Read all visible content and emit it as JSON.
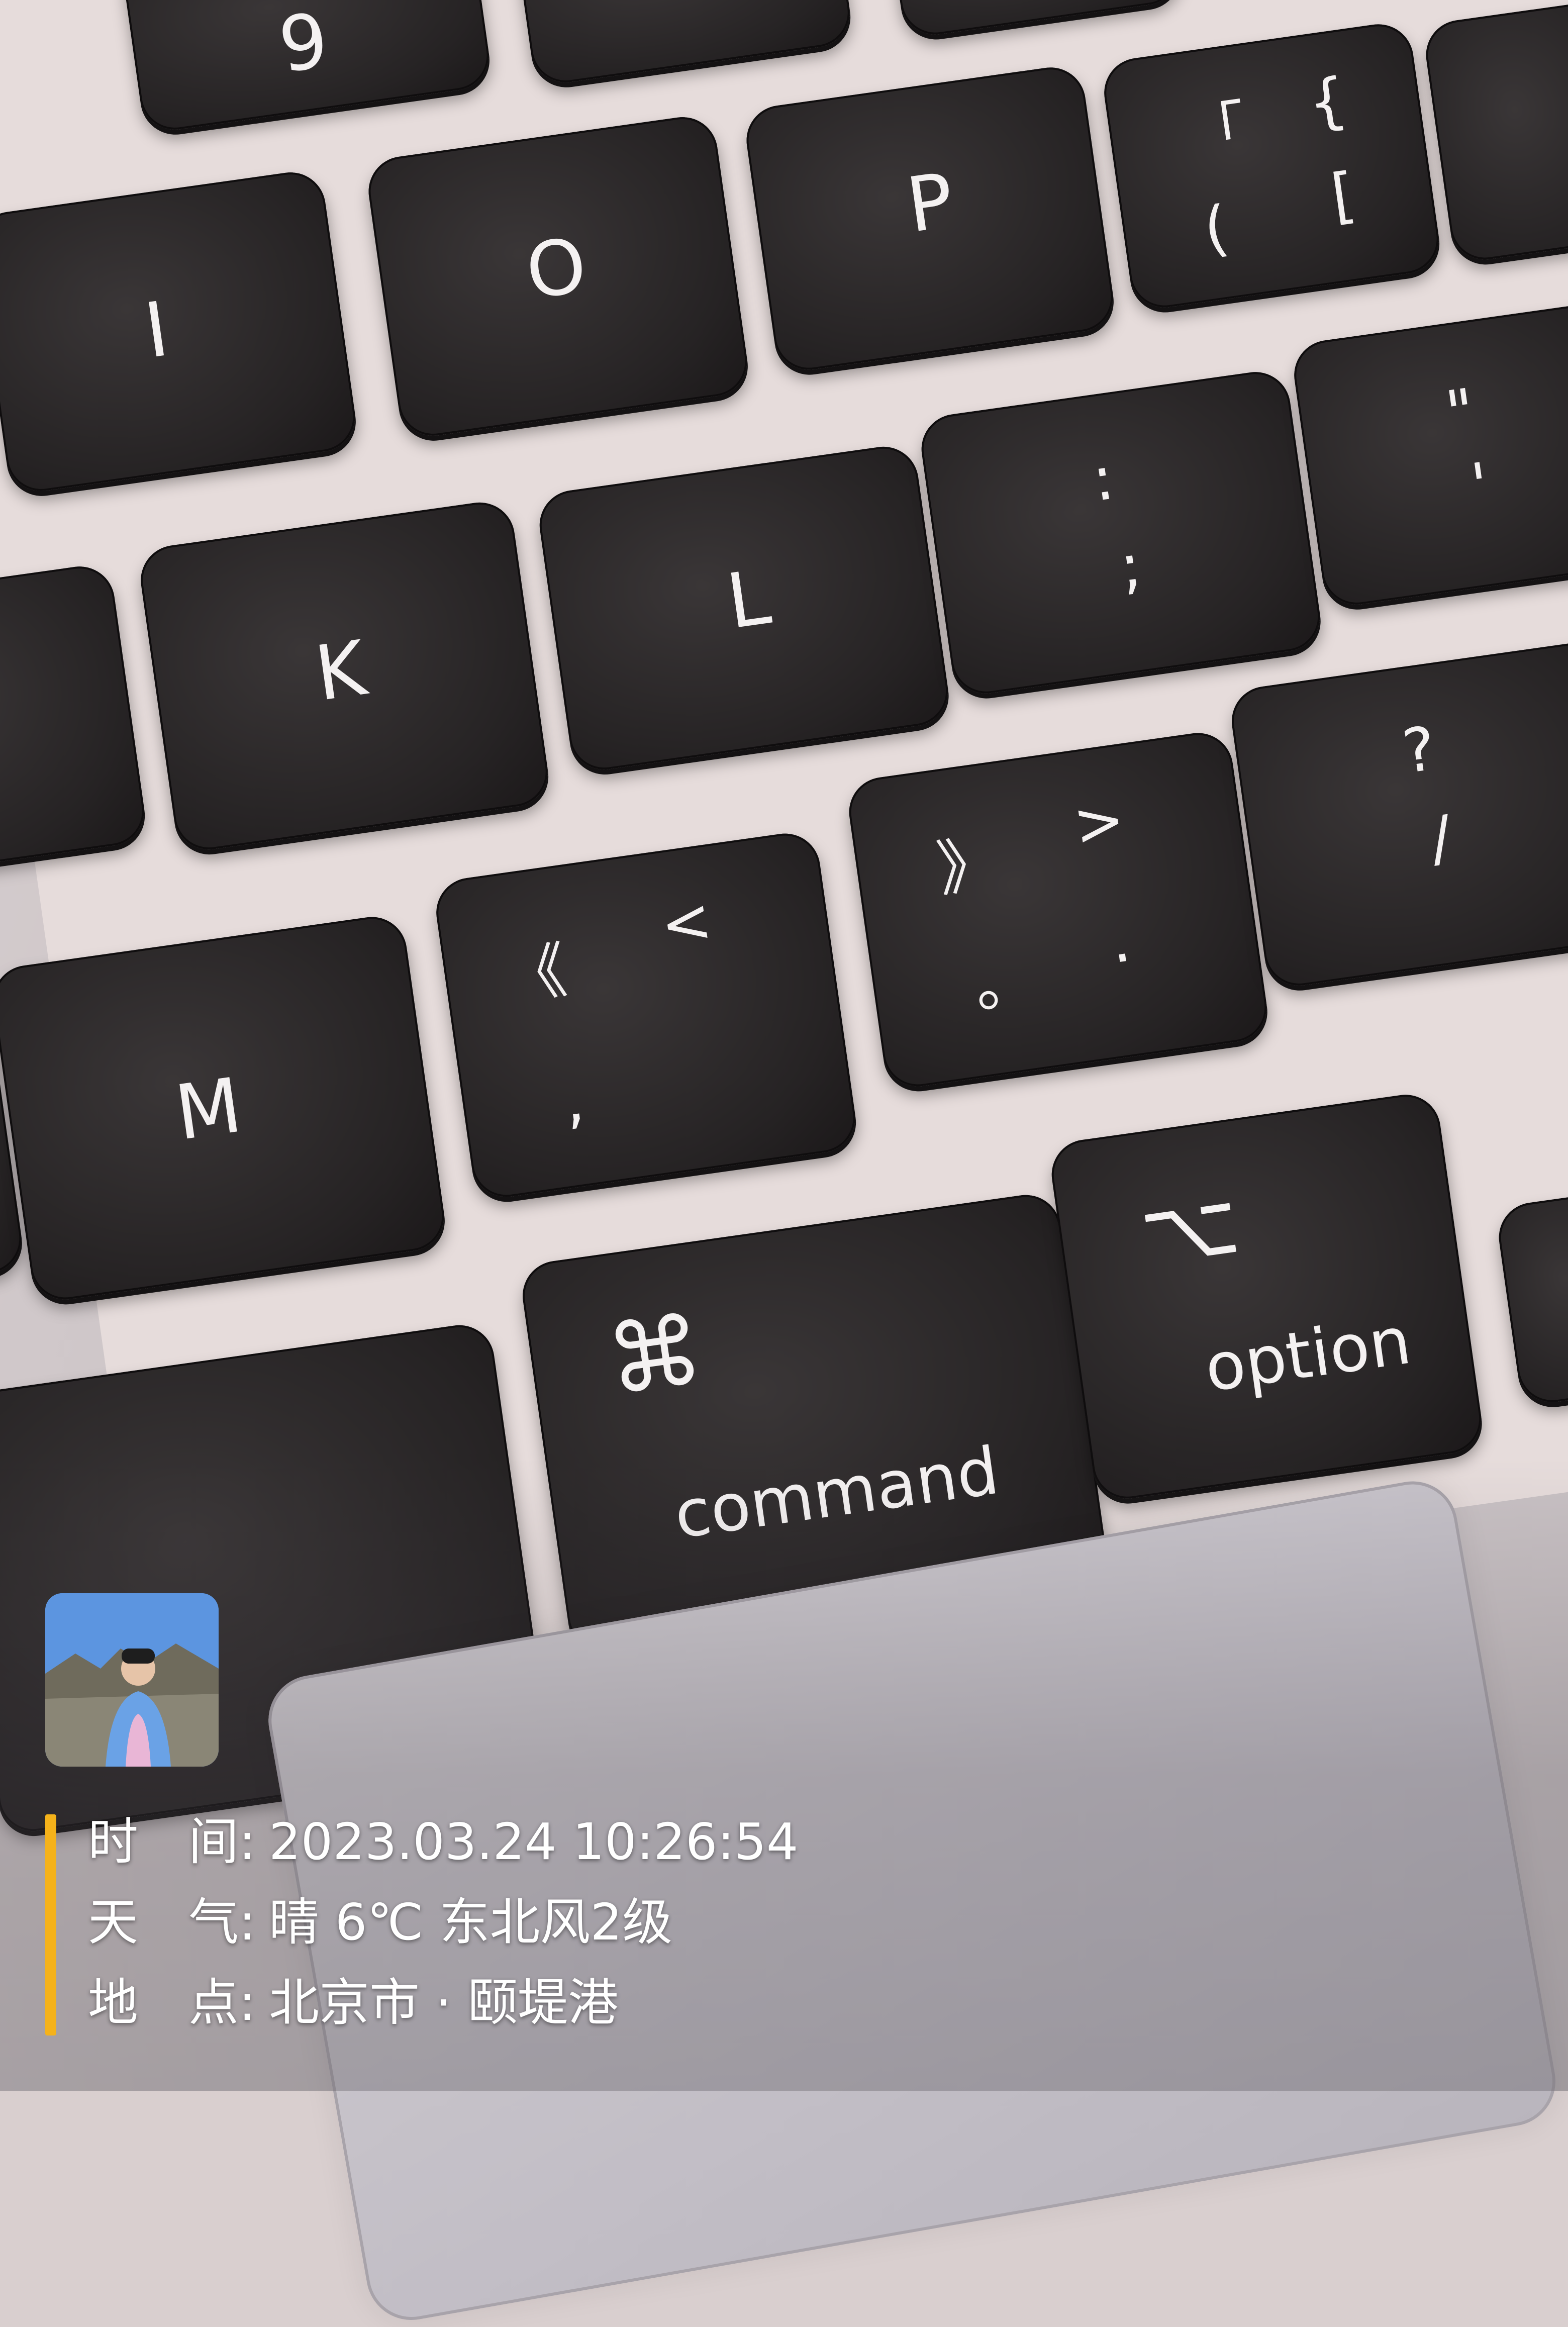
{
  "keys": {
    "nine": "9",
    "i": "I",
    "o": "O",
    "p": "P",
    "bracket_top_left": "「",
    "bracket_top_right": "{",
    "bracket_bottom_left": "(",
    "bracket_bottom_right": "[",
    "k": "K",
    "l": "L",
    "semicolon_top": ":",
    "semicolon_bottom": ";",
    "quote_top": "\"",
    "quote_bottom": "'",
    "m": "M",
    "comma_top_left": "《",
    "comma_top_right": "<",
    "comma_bottom": ",",
    "period_top_left": "》",
    "period_top_right": ">",
    "period_bottom_left": "。",
    "period_bottom_right": ".",
    "slash_top": "?",
    "slash_bottom": "/",
    "command_symbol": "⌘",
    "command_label": "command",
    "option_symbol": "⌥",
    "option_label": "option"
  },
  "watermark": {
    "time_label": "时　间:",
    "time_value": "2023.03.24 10:26:54",
    "weather_label": "天　气:",
    "weather_value": "晴 6℃  东北风2级",
    "location_label": "地　点:",
    "location_value": "北京市 · 颐堤港",
    "accent_color": "#f5b21a"
  }
}
